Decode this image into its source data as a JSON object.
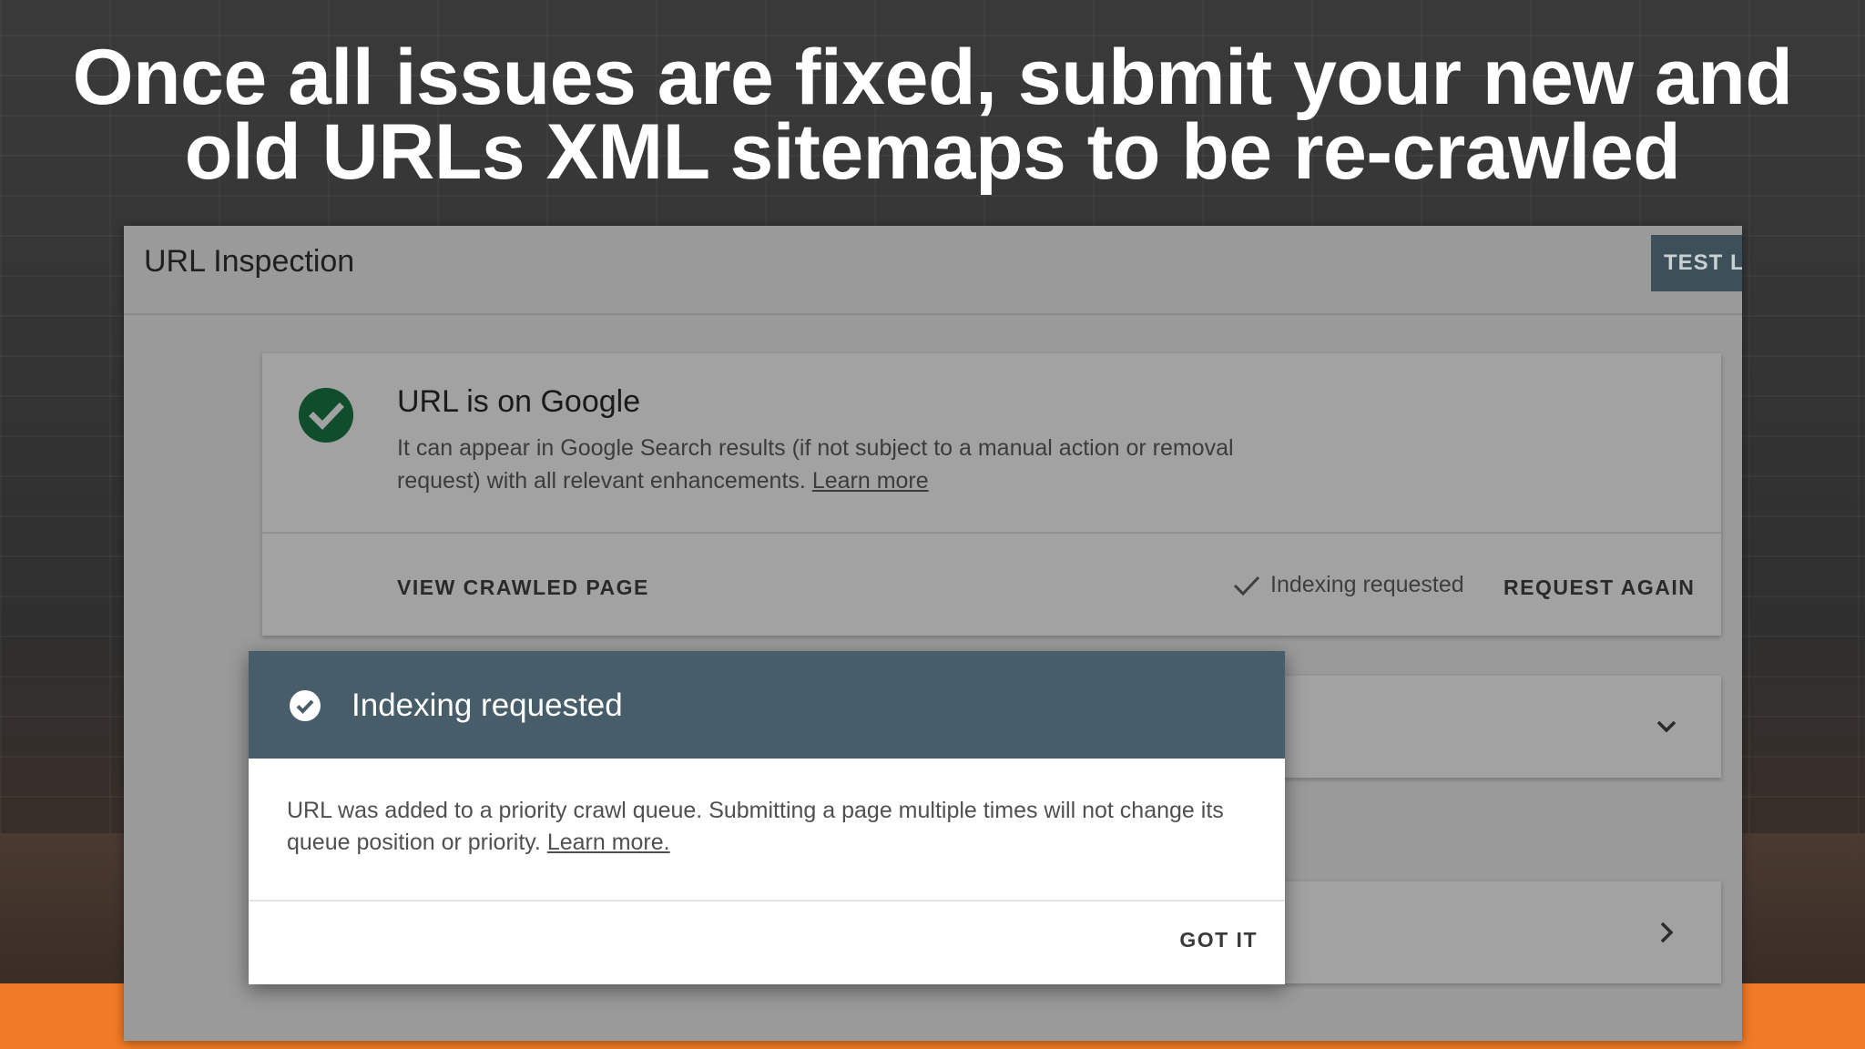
{
  "headline": {
    "line1": "Once all issues are fixed, submit your new and",
    "line2": "old URLs XML sitemaps to be re-crawled"
  },
  "panel": {
    "title": "URL Inspection",
    "test_button_label": "TEST L"
  },
  "status_card": {
    "heading": "URL is on Google",
    "description": "It can appear in Google Search results (if not subject to a manual action or removal request) with all relevant enhancements.",
    "learn_more": "Learn more",
    "view_crawled_label": "VIEW CRAWLED PAGE",
    "indexing_status": "Indexing requested",
    "request_again_label": "REQUEST AGAIN",
    "icon": "check-circle-icon"
  },
  "dialog": {
    "title": "Indexing requested",
    "body": "URL was added to a priority crawl queue. Submitting a page multiple times will not change its queue position or priority.",
    "learn_more": "Learn more.",
    "got_it_label": "GOT IT",
    "icon": "check-circle-icon"
  },
  "colors": {
    "accent_bar": "#f07a25",
    "dialog_header": "#485d6a",
    "status_icon": "#0f4d2c"
  }
}
